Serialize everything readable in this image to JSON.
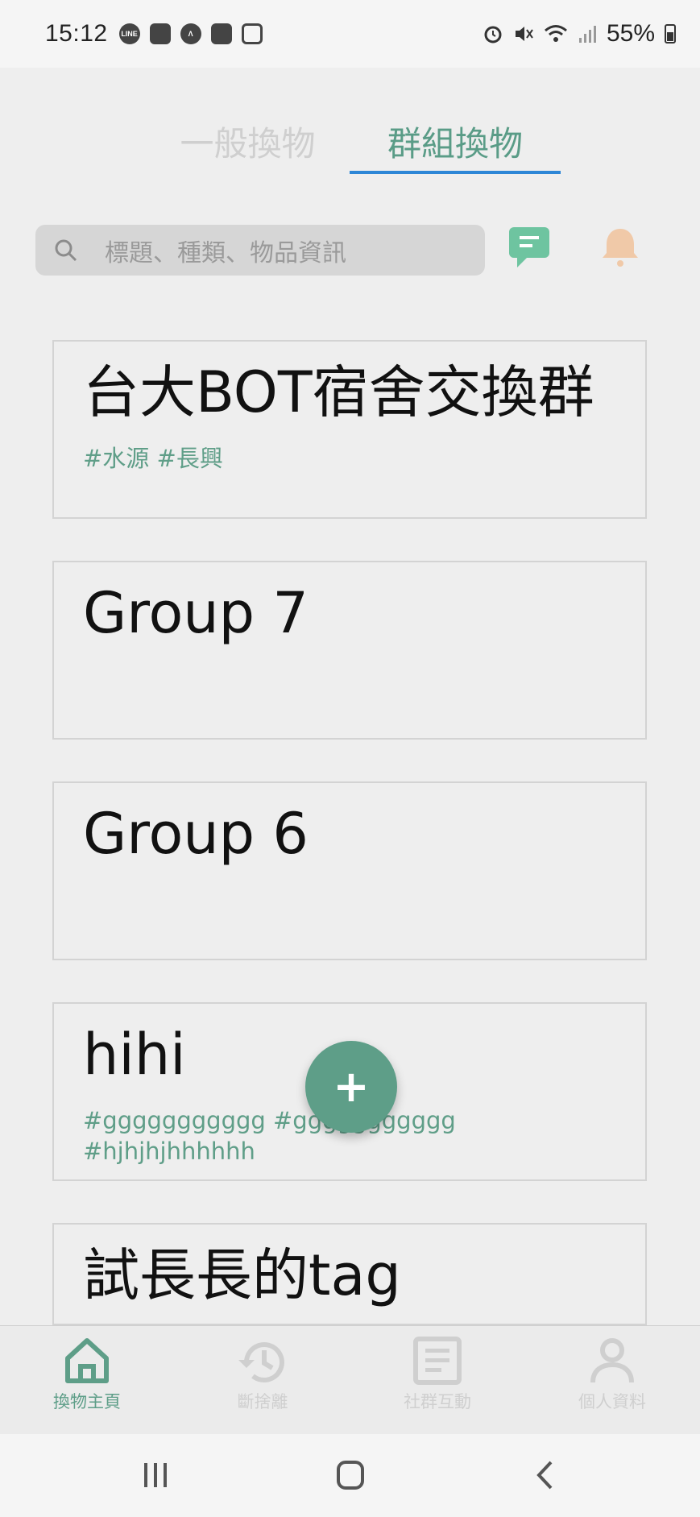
{
  "status_bar": {
    "time": "15:12",
    "left_icons": [
      "line-icon",
      "app-icon",
      "arc-icon",
      "app-icon",
      "instagram-icon"
    ],
    "line_label": "LINE",
    "battery": "55%",
    "right_icons": [
      "alarm-icon",
      "mute-icon",
      "wifi-icon",
      "signal-icon",
      "battery-icon"
    ]
  },
  "tabs": [
    {
      "label": "一般換物",
      "active": false
    },
    {
      "label": "群組換物",
      "active": true
    }
  ],
  "search": {
    "placeholder": "標題、種類、物品資訊"
  },
  "cards": [
    {
      "title": "台大BOT宿舍交換群",
      "tags": "#水源 #長興"
    },
    {
      "title": "Group 7",
      "tags": ""
    },
    {
      "title": "Group 6",
      "tags": ""
    },
    {
      "title": "hihi",
      "tags": "#ggggggggggg #ggggggggggg #hjhjhjhhhhhh"
    },
    {
      "title": "試長長的tag",
      "tags": ""
    }
  ],
  "fab": {
    "label": "+"
  },
  "bottom_nav": [
    {
      "label": "換物主頁",
      "icon": "home-icon",
      "active": true
    },
    {
      "label": "斷捨離",
      "icon": "history-icon",
      "active": false
    },
    {
      "label": "社群互動",
      "icon": "article-icon",
      "active": false
    },
    {
      "label": "個人資料",
      "icon": "person-icon",
      "active": false
    }
  ],
  "colors": {
    "accent": "#5e9e88",
    "tab_underline": "#2d86d6",
    "inactive": "#c8c8c8",
    "bell": "#f0c9a8",
    "chat": "#6ec4a0"
  }
}
